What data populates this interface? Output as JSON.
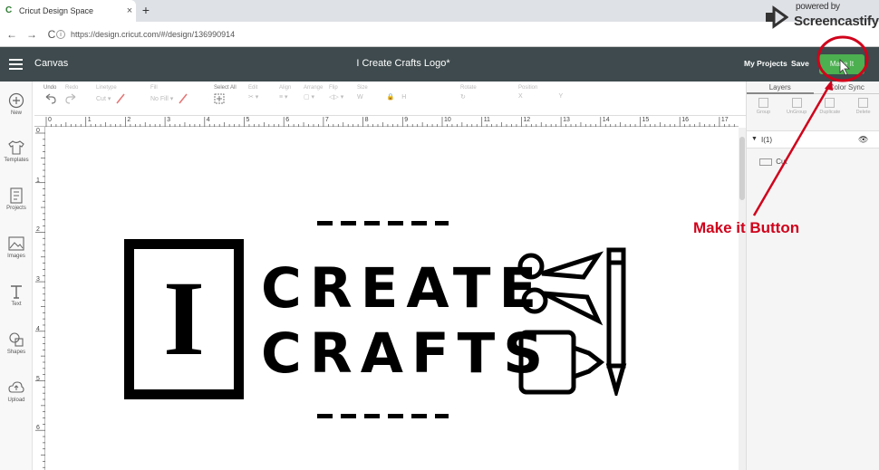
{
  "browser": {
    "tab_title": "Cricut Design Space",
    "tab_close": "×",
    "new_tab": "+",
    "url": "https://design.cricut.com/#/design/136990914",
    "back": "←",
    "forward": "→",
    "reload": "C"
  },
  "watermark": {
    "powered_by": "powered by",
    "brand": "Screencastify"
  },
  "header": {
    "menu_label": "Canvas",
    "project_title": "I Create Crafts Logo*",
    "my_projects": "My Projects",
    "save": "Save",
    "make_it": "Make It"
  },
  "toolbar": {
    "undo": "Undo",
    "redo": "Redo",
    "linetype": "Linetype",
    "linetype_value": "Cut",
    "fill": "Fill",
    "fill_value": "No Fill",
    "select_all": "Select All",
    "edit": "Edit",
    "align": "Align",
    "arrange": "Arrange",
    "flip": "Flip",
    "size": "Size",
    "size_w": "W",
    "size_h": "H",
    "rotate": "Rotate",
    "position": "Position",
    "position_x": "X",
    "position_y": "Y"
  },
  "sidebar": {
    "items": [
      {
        "label": "New",
        "icon": "plus-circle-icon"
      },
      {
        "label": "Templates",
        "icon": "tshirt-icon"
      },
      {
        "label": "Projects",
        "icon": "projects-icon"
      },
      {
        "label": "Images",
        "icon": "image-icon"
      },
      {
        "label": "Text",
        "icon": "text-icon"
      },
      {
        "label": "Shapes",
        "icon": "shapes-icon"
      },
      {
        "label": "Upload",
        "icon": "upload-icon"
      }
    ]
  },
  "layers": {
    "tab_layers": "Layers",
    "tab_color_sync": "Color Sync",
    "tools": [
      "Group",
      "UnGroup",
      "Duplicate",
      "Delete"
    ],
    "group_name": "I(1)",
    "layer_name": "Cut"
  },
  "ruler": {
    "h": [
      "0",
      "1",
      "2",
      "3",
      "4",
      "5",
      "6",
      "7",
      "8",
      "9",
      "10",
      "11",
      "12",
      "13",
      "14",
      "15",
      "16",
      "17"
    ],
    "v": [
      "0",
      "1",
      "2",
      "3",
      "4",
      "5",
      "6"
    ]
  },
  "design": {
    "letter": "I",
    "line1": "CREATE",
    "line2": "CRAFTS"
  },
  "annotation": {
    "label": "Make it Button",
    "color": "#d0021b"
  },
  "colors": {
    "header_bg": "#3e4a4d",
    "make_it_bg": "#4caf50"
  }
}
